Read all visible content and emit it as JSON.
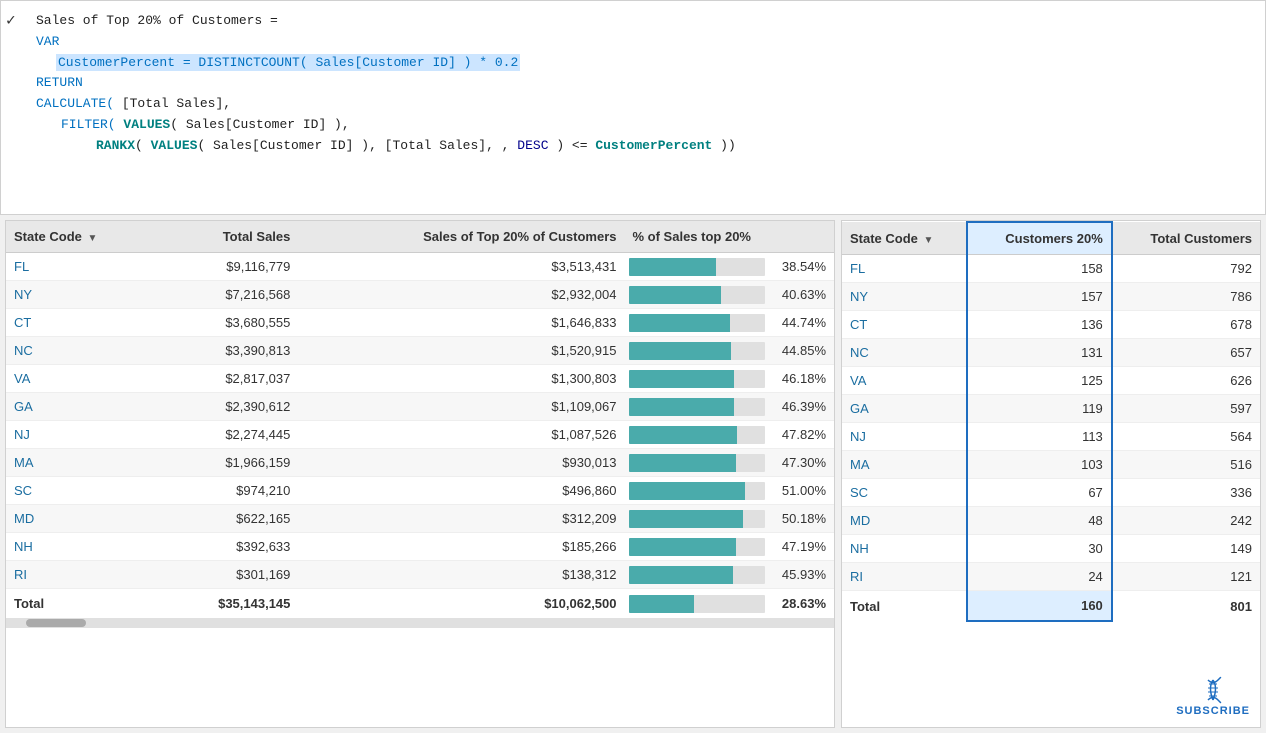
{
  "code": {
    "line1": "Sales of Top 20% of Customers =",
    "line2": "VAR",
    "line3_pre": "",
    "line3_highlight": "CustomerPercent = DISTINCTCOUNT( Sales[Customer ID] ) * 0.2",
    "line4": "RETURN",
    "line5": "CALCULATE( [Total Sales],",
    "line6": "    FILTER( VALUES( Sales[Customer ID] ),",
    "line7": "        RANKX( VALUES( Sales[Customer ID] ), [Total Sales], , DESC ) <= CustomerPercent ))"
  },
  "left_table": {
    "headers": [
      "State Code",
      "Total Sales",
      "Sales of Top 20% of Customers",
      "% of Sales top 20%"
    ],
    "rows": [
      {
        "state": "FL",
        "total_sales": "$9,116,779",
        "top20_sales": "$3,513,431",
        "pct": "38.54%",
        "bar_pct": 38.54
      },
      {
        "state": "NY",
        "total_sales": "$7,216,568",
        "top20_sales": "$2,932,004",
        "pct": "40.63%",
        "bar_pct": 40.63
      },
      {
        "state": "CT",
        "total_sales": "$3,680,555",
        "top20_sales": "$1,646,833",
        "pct": "44.74%",
        "bar_pct": 44.74
      },
      {
        "state": "NC",
        "total_sales": "$3,390,813",
        "top20_sales": "$1,520,915",
        "pct": "44.85%",
        "bar_pct": 44.85
      },
      {
        "state": "VA",
        "total_sales": "$2,817,037",
        "top20_sales": "$1,300,803",
        "pct": "46.18%",
        "bar_pct": 46.18
      },
      {
        "state": "GA",
        "total_sales": "$2,390,612",
        "top20_sales": "$1,109,067",
        "pct": "46.39%",
        "bar_pct": 46.39
      },
      {
        "state": "NJ",
        "total_sales": "$2,274,445",
        "top20_sales": "$1,087,526",
        "pct": "47.82%",
        "bar_pct": 47.82
      },
      {
        "state": "MA",
        "total_sales": "$1,966,159",
        "top20_sales": "$930,013",
        "pct": "47.30%",
        "bar_pct": 47.3
      },
      {
        "state": "SC",
        "total_sales": "$974,210",
        "top20_sales": "$496,860",
        "pct": "51.00%",
        "bar_pct": 51.0
      },
      {
        "state": "MD",
        "total_sales": "$622,165",
        "top20_sales": "$312,209",
        "pct": "50.18%",
        "bar_pct": 50.18
      },
      {
        "state": "NH",
        "total_sales": "$392,633",
        "top20_sales": "$185,266",
        "pct": "47.19%",
        "bar_pct": 47.19
      },
      {
        "state": "RI",
        "total_sales": "$301,169",
        "top20_sales": "$138,312",
        "pct": "45.93%",
        "bar_pct": 45.93
      }
    ],
    "footer": {
      "state": "Total",
      "total_sales": "$35,143,145",
      "top20_sales": "$10,062,500",
      "pct": "28.63%",
      "bar_pct": 28.63
    }
  },
  "right_table": {
    "headers": [
      "State Code",
      "Customers 20%",
      "Total Customers"
    ],
    "header_highlight": "Customers 20%",
    "rows": [
      {
        "state": "FL",
        "cust20": "158",
        "total_cust": "792"
      },
      {
        "state": "NY",
        "cust20": "157",
        "total_cust": "786"
      },
      {
        "state": "CT",
        "cust20": "136",
        "total_cust": "678"
      },
      {
        "state": "NC",
        "cust20": "131",
        "total_cust": "657"
      },
      {
        "state": "VA",
        "cust20": "125",
        "total_cust": "626"
      },
      {
        "state": "GA",
        "cust20": "119",
        "total_cust": "597"
      },
      {
        "state": "NJ",
        "cust20": "113",
        "total_cust": "564"
      },
      {
        "state": "MA",
        "cust20": "103",
        "total_cust": "516"
      },
      {
        "state": "SC",
        "cust20": "67",
        "total_cust": "336"
      },
      {
        "state": "MD",
        "cust20": "48",
        "total_cust": "242"
      },
      {
        "state": "NH",
        "cust20": "30",
        "total_cust": "149"
      },
      {
        "state": "RI",
        "cust20": "24",
        "total_cust": "121"
      }
    ],
    "footer": {
      "state": "Total",
      "cust20": "160",
      "total_cust": "801"
    }
  },
  "subscribe_label": "SUBSCRIBE",
  "bar_color": "#4aabab",
  "highlight_color": "#1e6dc0"
}
